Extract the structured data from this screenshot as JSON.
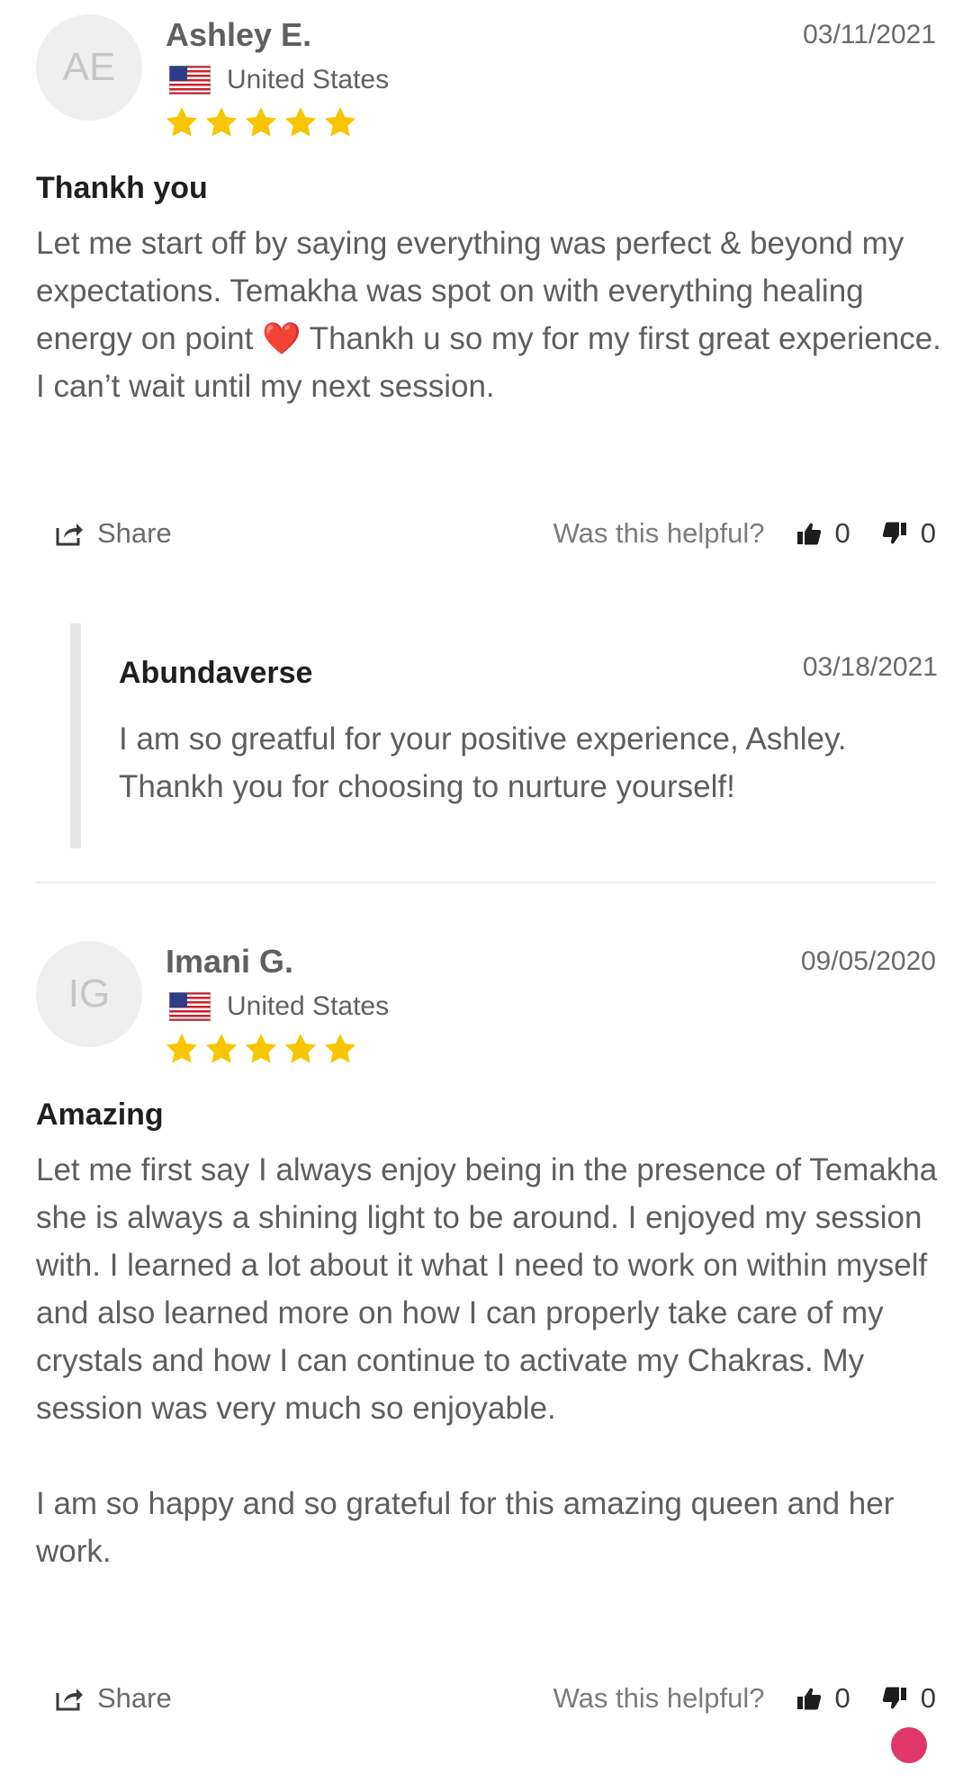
{
  "reviews": [
    {
      "initials": "AE",
      "author": "Ashley E.",
      "country": "United States",
      "date": "03/11/2021",
      "rating": 5,
      "title": "Thankh you",
      "body": "Let me start off by saying everything was perfect & beyond my expectations. Temakha was spot on with everything healing energy on point ❤️ Thankh u so my for my first great experience. I can’t wait until my next session.",
      "share_label": "Share",
      "helpful_label": "Was this helpful?",
      "upvotes": "0",
      "downvotes": "0",
      "reply": {
        "author": "Abundaverse",
        "date": "03/18/2021",
        "body": "I am so greatful for your positive experience, Ashley. Thankh you for choosing to nurture yourself!"
      }
    },
    {
      "initials": "IG",
      "author": "Imani G.",
      "country": "United States",
      "date": "09/05/2020",
      "rating": 5,
      "title": "Amazing",
      "body": "Let me first say I always enjoy being in the presence of Temakha she is always a shining light to be around. I enjoyed my session with. I learned a lot about it what I need to work on within myself and also learned more on how I can properly take care of my crystals and how I can continue to activate my Chakras. My session was very much so enjoyable.\n\nI am so happy and so grateful for this amazing queen and her work.",
      "share_label": "Share",
      "helpful_label": "Was this helpful?",
      "upvotes": "0",
      "downvotes": "0"
    }
  ],
  "colors": {
    "star": "#f7c600",
    "avatar_bg": "#efefef",
    "reply_bar": "#e6e6e6",
    "fab": "#e0386b"
  },
  "icons": {
    "share": "share-icon",
    "thumbs_up": "thumbs-up-icon",
    "thumbs_down": "thumbs-down-icon",
    "flag": "us-flag-icon",
    "star": "star-icon"
  }
}
